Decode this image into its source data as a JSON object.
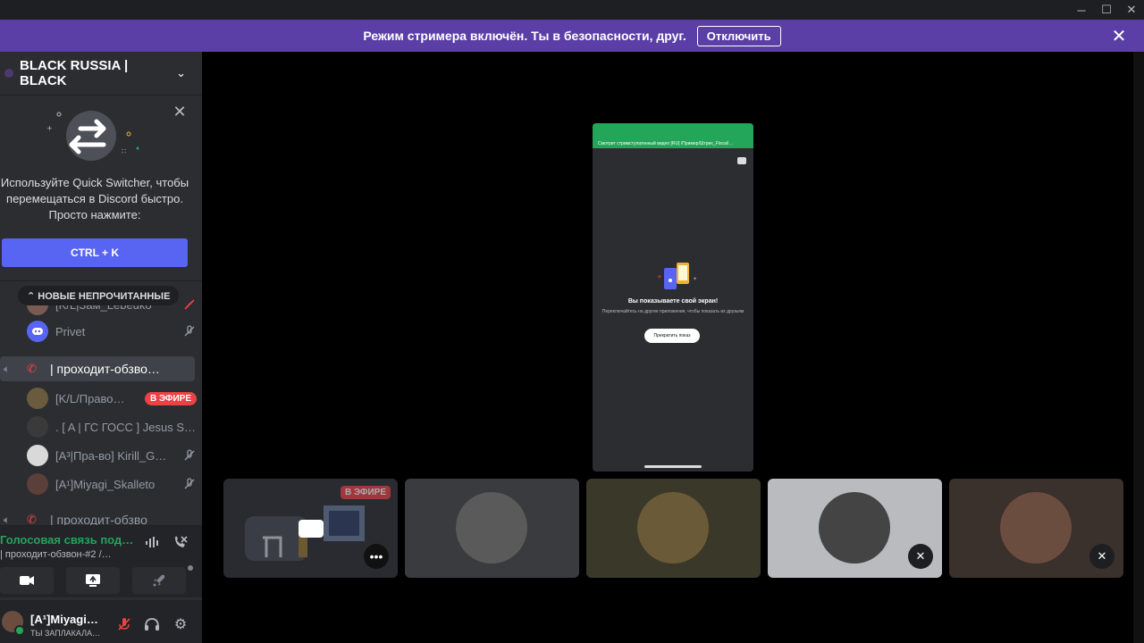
{
  "window": {
    "minimize_glyph": "─",
    "maximize_glyph": "☐",
    "close_glyph": "✕"
  },
  "banner": {
    "text": "Режим стримера включён. Ты в безопасности, друг.",
    "button": "Отключить",
    "close_glyph": "✕"
  },
  "server": {
    "name": "BLACK RUSSIA | BLACK",
    "chevron": "⌄"
  },
  "quick_switcher": {
    "text": "Используйте Quick Switcher, чтобы перемещаться в Discord быстро. Просто нажмите:",
    "shortcut": "CTRL + K",
    "close_glyph": "✕"
  },
  "unread_pill": "⌃ НОВЫЕ НЕПРОЧИТАННЫЕ",
  "members_top": [
    {
      "name": "[K/L|Зам_Lebeuko",
      "avatar_color": "#7a5a52"
    },
    {
      "name": "Privet",
      "avatar_color": "#5865f2"
    }
  ],
  "channel_active": {
    "name": "| проходит-обзво…"
  },
  "members_voice": [
    {
      "name": "[K/L/Право…",
      "avatar_color": "#6b5b3e",
      "live": "В ЭФИРЕ"
    },
    {
      "name": ". [ A | ГС ГОСС ] Jesus St…",
      "avatar_color": "#3a3a3a"
    },
    {
      "name": "[A³|Пра-во] Kirill_G…",
      "avatar_color": "#d9d9d9"
    },
    {
      "name": "[A¹]Miyagi_Skalleto",
      "avatar_color": "#5a4038"
    }
  ],
  "channel_next": {
    "name": "| проходит-обзво"
  },
  "voice_panel": {
    "status": "Голосовая связь под…",
    "channel": "| проходит-обзвон-#2 /…"
  },
  "user": {
    "name": "[A¹]Miyagi…",
    "status": "ТЫ ЗАПЛАКАЛА…"
  },
  "stream": {
    "notification": "Смотрит стримстулатенный видео [RU] /Пример/Штрих_Flocal/…",
    "title": "Вы показываете свой экран!",
    "description": "Переключайтесь на другие приложения, чтобы показать их друзьям",
    "button": "Прекратить показ"
  },
  "tiles": [
    {
      "live": "В ЭФИРЕ",
      "more": "•••",
      "bg": "#2a2b30"
    },
    {
      "bg": "#3a3b3f",
      "avatar_color": "#5a5a5a"
    },
    {
      "bg": "#3a3828",
      "avatar_color": "#6a5a38"
    },
    {
      "bg": "#b9bbbe",
      "avatar_color": "#444",
      "mute": "✕"
    },
    {
      "bg": "#3a302c",
      "avatar_color": "#6b4d3f",
      "mute": "✕"
    }
  ],
  "colors": {
    "banner": "#5b3fa6",
    "accent": "#5865f2",
    "live": "#ed4245",
    "online": "#23a55a"
  }
}
